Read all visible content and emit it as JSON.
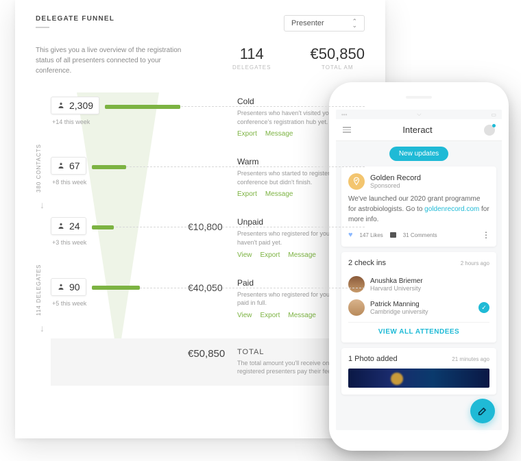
{
  "dashboard": {
    "title": "DELEGATE FUNNEL",
    "dropdown": "Presenter",
    "description": "This gives you a live overview of the registration status of all presenters connected to your conference.",
    "metric_delegates_num": "114",
    "metric_delegates_lbl": "DELEGATES",
    "metric_total_num": "€50,850",
    "metric_total_lbl": "TOTAL AM",
    "side_contacts": "380 CONTACTS",
    "side_delegates": "114 DELEGATES",
    "stages": [
      {
        "count": "2,309",
        "week": "+14 this week",
        "amount": "",
        "name": "Cold",
        "desc": "Presenters who haven't visited your conference's registration hub yet.",
        "actions": [
          "Export",
          "Message"
        ]
      },
      {
        "count": "67",
        "week": "+8 this week",
        "amount": "",
        "name": "Warm",
        "desc": "Presenters who started to register for conference but didn't finish.",
        "actions": [
          "Export",
          "Message"
        ]
      },
      {
        "count": "24",
        "week": "+3 this week",
        "amount": "€10,800",
        "name": "Unpaid",
        "desc": "Presenters who registered for your c but haven't paid yet.",
        "actions": [
          "View",
          "Export",
          "Message"
        ]
      },
      {
        "count": "90",
        "week": "+5 this week",
        "amount": "€40,050",
        "name": "Paid",
        "desc": "Presenters who registered for your c and have paid in full.",
        "actions": [
          "View",
          "Export",
          "Message"
        ]
      }
    ],
    "total_amount": "€50,850",
    "total_name": "TOTAL",
    "total_desc": "The total amount you'll receive once registered presenters pay their fees."
  },
  "phone": {
    "title": "Interact",
    "new_updates": "New updates",
    "post": {
      "author": "Golden Record",
      "sub": "Sponsored",
      "body_pre": "We've launched our 2020 grant programme for astrobiologists. Go to ",
      "body_link": "goldenrecord.com",
      "body_post": " for more info.",
      "likes": "147 Likes",
      "comments": "31 Comments"
    },
    "checkins": {
      "title": "2 check ins",
      "time": "2 hours ago",
      "list": [
        {
          "name": "Anushka Briemer",
          "org": "Harvard University"
        },
        {
          "name": "Patrick Manning",
          "org": "Cambridge university"
        }
      ],
      "view_all": "VIEW ALL ATTENDEES"
    },
    "photo": {
      "title": "1 Photo added",
      "time": "21 minutes ago"
    }
  }
}
